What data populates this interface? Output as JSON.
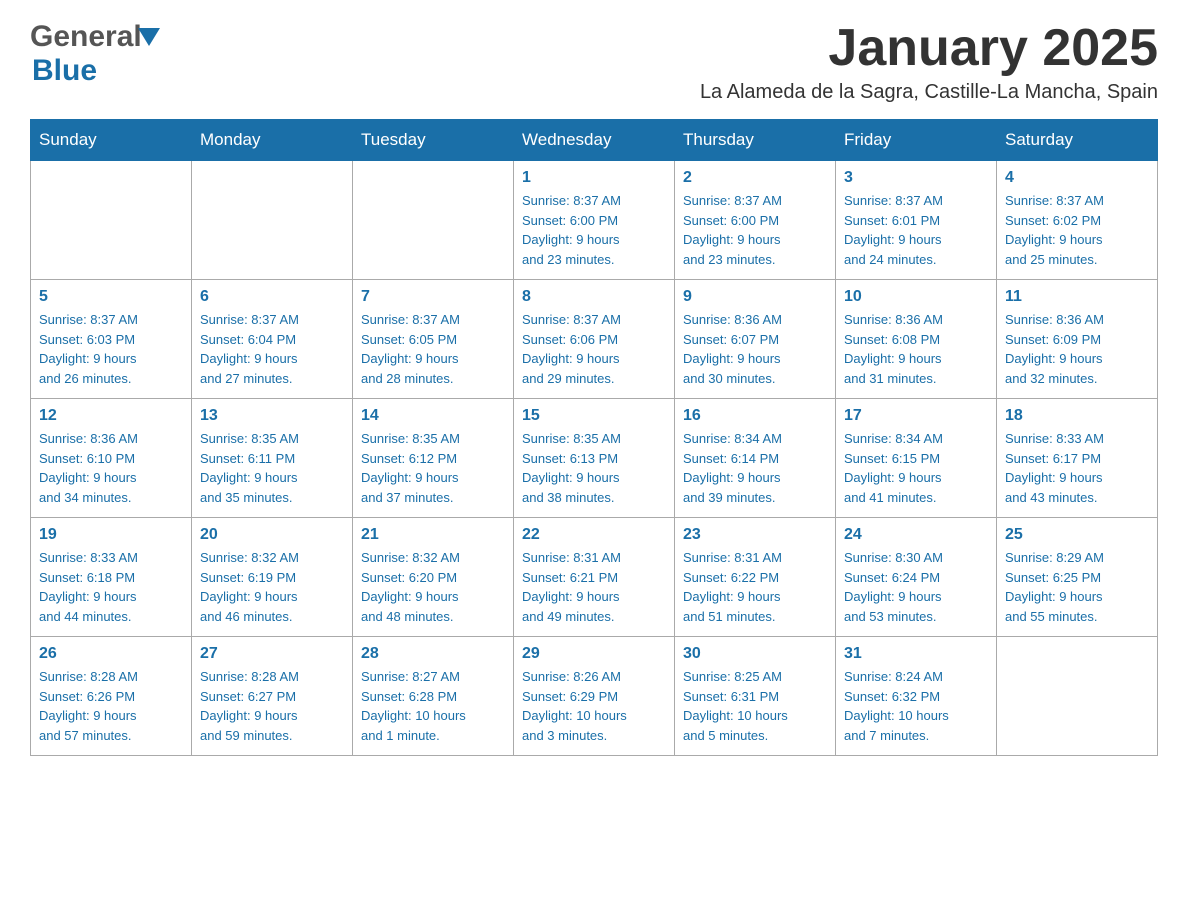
{
  "header": {
    "logo_general": "General",
    "logo_blue": "Blue",
    "month_title": "January 2025",
    "location": "La Alameda de la Sagra, Castille-La Mancha, Spain"
  },
  "days_of_week": [
    "Sunday",
    "Monday",
    "Tuesday",
    "Wednesday",
    "Thursday",
    "Friday",
    "Saturday"
  ],
  "weeks": [
    [
      {
        "day": "",
        "info": ""
      },
      {
        "day": "",
        "info": ""
      },
      {
        "day": "",
        "info": ""
      },
      {
        "day": "1",
        "info": "Sunrise: 8:37 AM\nSunset: 6:00 PM\nDaylight: 9 hours\nand 23 minutes."
      },
      {
        "day": "2",
        "info": "Sunrise: 8:37 AM\nSunset: 6:00 PM\nDaylight: 9 hours\nand 23 minutes."
      },
      {
        "day": "3",
        "info": "Sunrise: 8:37 AM\nSunset: 6:01 PM\nDaylight: 9 hours\nand 24 minutes."
      },
      {
        "day": "4",
        "info": "Sunrise: 8:37 AM\nSunset: 6:02 PM\nDaylight: 9 hours\nand 25 minutes."
      }
    ],
    [
      {
        "day": "5",
        "info": "Sunrise: 8:37 AM\nSunset: 6:03 PM\nDaylight: 9 hours\nand 26 minutes."
      },
      {
        "day": "6",
        "info": "Sunrise: 8:37 AM\nSunset: 6:04 PM\nDaylight: 9 hours\nand 27 minutes."
      },
      {
        "day": "7",
        "info": "Sunrise: 8:37 AM\nSunset: 6:05 PM\nDaylight: 9 hours\nand 28 minutes."
      },
      {
        "day": "8",
        "info": "Sunrise: 8:37 AM\nSunset: 6:06 PM\nDaylight: 9 hours\nand 29 minutes."
      },
      {
        "day": "9",
        "info": "Sunrise: 8:36 AM\nSunset: 6:07 PM\nDaylight: 9 hours\nand 30 minutes."
      },
      {
        "day": "10",
        "info": "Sunrise: 8:36 AM\nSunset: 6:08 PM\nDaylight: 9 hours\nand 31 minutes."
      },
      {
        "day": "11",
        "info": "Sunrise: 8:36 AM\nSunset: 6:09 PM\nDaylight: 9 hours\nand 32 minutes."
      }
    ],
    [
      {
        "day": "12",
        "info": "Sunrise: 8:36 AM\nSunset: 6:10 PM\nDaylight: 9 hours\nand 34 minutes."
      },
      {
        "day": "13",
        "info": "Sunrise: 8:35 AM\nSunset: 6:11 PM\nDaylight: 9 hours\nand 35 minutes."
      },
      {
        "day": "14",
        "info": "Sunrise: 8:35 AM\nSunset: 6:12 PM\nDaylight: 9 hours\nand 37 minutes."
      },
      {
        "day": "15",
        "info": "Sunrise: 8:35 AM\nSunset: 6:13 PM\nDaylight: 9 hours\nand 38 minutes."
      },
      {
        "day": "16",
        "info": "Sunrise: 8:34 AM\nSunset: 6:14 PM\nDaylight: 9 hours\nand 39 minutes."
      },
      {
        "day": "17",
        "info": "Sunrise: 8:34 AM\nSunset: 6:15 PM\nDaylight: 9 hours\nand 41 minutes."
      },
      {
        "day": "18",
        "info": "Sunrise: 8:33 AM\nSunset: 6:17 PM\nDaylight: 9 hours\nand 43 minutes."
      }
    ],
    [
      {
        "day": "19",
        "info": "Sunrise: 8:33 AM\nSunset: 6:18 PM\nDaylight: 9 hours\nand 44 minutes."
      },
      {
        "day": "20",
        "info": "Sunrise: 8:32 AM\nSunset: 6:19 PM\nDaylight: 9 hours\nand 46 minutes."
      },
      {
        "day": "21",
        "info": "Sunrise: 8:32 AM\nSunset: 6:20 PM\nDaylight: 9 hours\nand 48 minutes."
      },
      {
        "day": "22",
        "info": "Sunrise: 8:31 AM\nSunset: 6:21 PM\nDaylight: 9 hours\nand 49 minutes."
      },
      {
        "day": "23",
        "info": "Sunrise: 8:31 AM\nSunset: 6:22 PM\nDaylight: 9 hours\nand 51 minutes."
      },
      {
        "day": "24",
        "info": "Sunrise: 8:30 AM\nSunset: 6:24 PM\nDaylight: 9 hours\nand 53 minutes."
      },
      {
        "day": "25",
        "info": "Sunrise: 8:29 AM\nSunset: 6:25 PM\nDaylight: 9 hours\nand 55 minutes."
      }
    ],
    [
      {
        "day": "26",
        "info": "Sunrise: 8:28 AM\nSunset: 6:26 PM\nDaylight: 9 hours\nand 57 minutes."
      },
      {
        "day": "27",
        "info": "Sunrise: 8:28 AM\nSunset: 6:27 PM\nDaylight: 9 hours\nand 59 minutes."
      },
      {
        "day": "28",
        "info": "Sunrise: 8:27 AM\nSunset: 6:28 PM\nDaylight: 10 hours\nand 1 minute."
      },
      {
        "day": "29",
        "info": "Sunrise: 8:26 AM\nSunset: 6:29 PM\nDaylight: 10 hours\nand 3 minutes."
      },
      {
        "day": "30",
        "info": "Sunrise: 8:25 AM\nSunset: 6:31 PM\nDaylight: 10 hours\nand 5 minutes."
      },
      {
        "day": "31",
        "info": "Sunrise: 8:24 AM\nSunset: 6:32 PM\nDaylight: 10 hours\nand 7 minutes."
      },
      {
        "day": "",
        "info": ""
      }
    ]
  ]
}
